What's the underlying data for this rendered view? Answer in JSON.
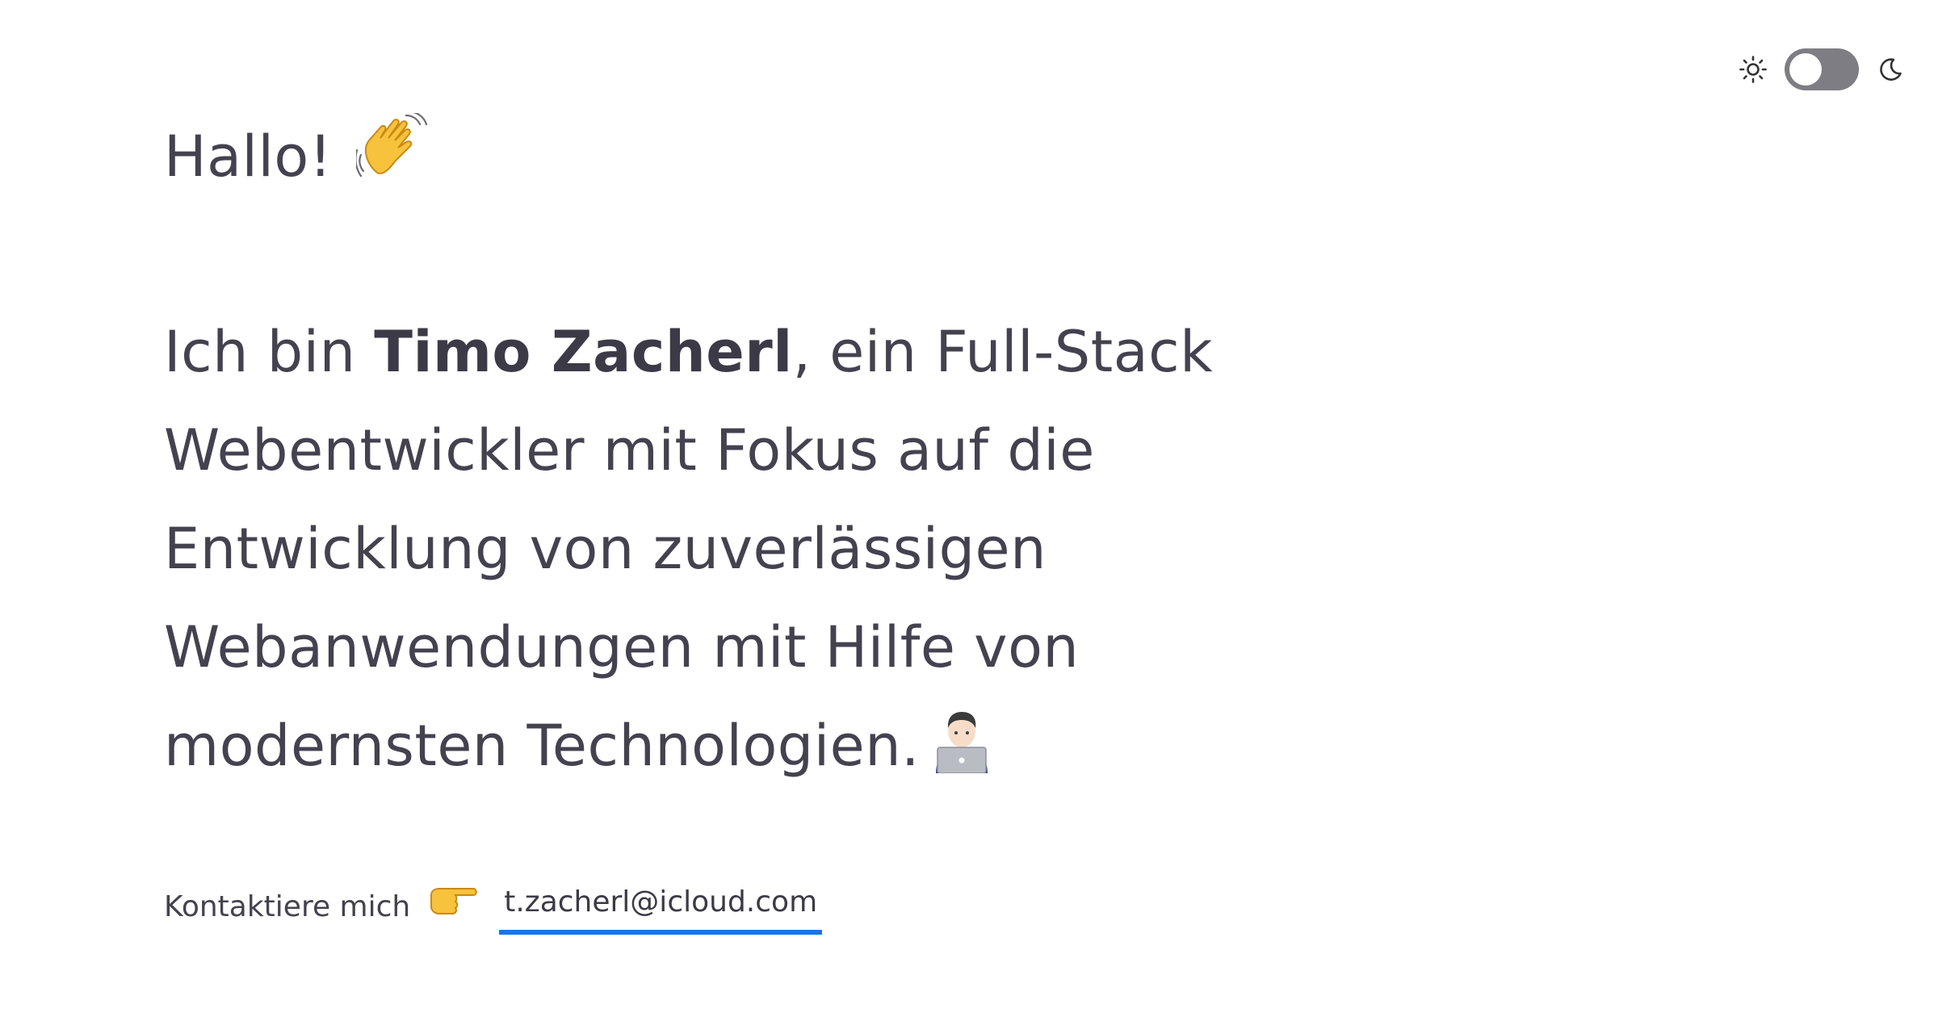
{
  "theme_switch": {
    "light_icon": "sun-icon",
    "dark_icon": "moon-icon",
    "state": "light"
  },
  "greeting": {
    "text": "Hallo!",
    "emoji": "waving-hand-emoji"
  },
  "intro": {
    "prefix": "Ich bin ",
    "name": "Timo Zacherl",
    "line1_rest": ", ein Full-Stack",
    "line2": "Webentwickler mit Fokus auf die",
    "line3": "Entwicklung von zuverlässigen",
    "line4": "Webanwendungen mit Hilfe von",
    "line5": "modernsten Technologien.",
    "emoji": "technologist-emoji"
  },
  "contact": {
    "label": "Kontaktiere mich",
    "emoji": "pointing-right-emoji",
    "email": "t.zacherl@icloud.com"
  },
  "colors": {
    "text": "#44424f",
    "link_underline": "#1a73e8",
    "toggle_track": "#7d7d83",
    "background": "#ffffff"
  }
}
